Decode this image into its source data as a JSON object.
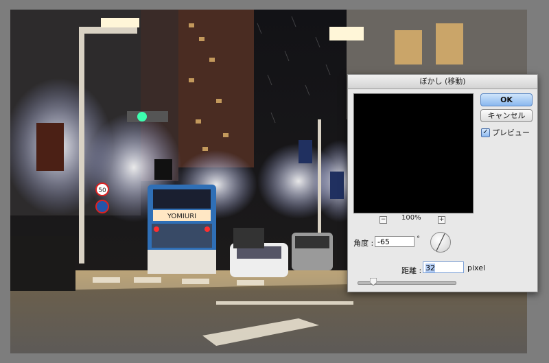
{
  "dialog": {
    "title": "ぼかし (移動)",
    "ok_label": "OK",
    "cancel_label": "キャンセル",
    "preview_label": "プレビュー",
    "preview_checked": true,
    "zoom_minus": "−",
    "zoom_plus": "+",
    "zoom_level": "100%",
    "angle_label": "角度 :",
    "angle_value": "-65",
    "angle_unit": "°",
    "distance_label": "距離 :",
    "distance_value": "32",
    "distance_unit": "pixel"
  },
  "photo_signs": {
    "bus_sign": "YOMIURI",
    "speed_limit": "50"
  },
  "colors": {
    "dialog_bg": "#e8e8e8",
    "ok_accent": "#8ab8ef",
    "traffic_light_green": "#3dffb0"
  }
}
